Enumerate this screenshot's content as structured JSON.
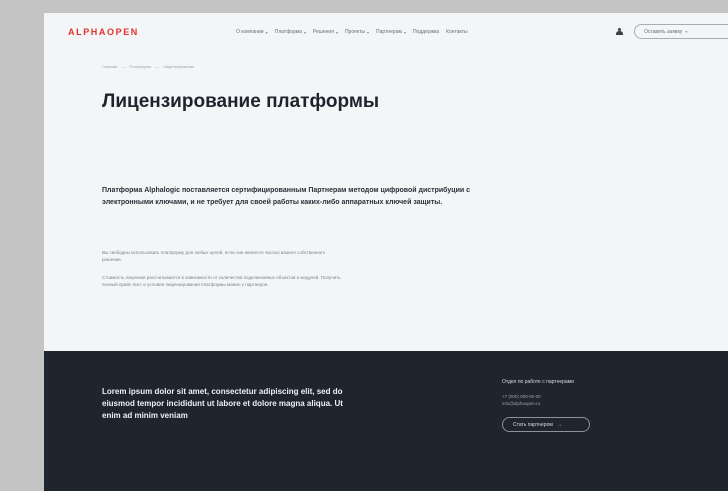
{
  "header": {
    "logo": "ALPHAOPEN",
    "nav": [
      {
        "label": "О компании",
        "has_dropdown": true
      },
      {
        "label": "Платформа",
        "has_dropdown": true
      },
      {
        "label": "Решения",
        "has_dropdown": true
      },
      {
        "label": "Проекты",
        "has_dropdown": true
      },
      {
        "label": "Партнерам",
        "has_dropdown": true
      },
      {
        "label": "Поддержка",
        "has_dropdown": false
      },
      {
        "label": "Контакты",
        "has_dropdown": false
      }
    ],
    "contact_button": "Оставить заявку"
  },
  "breadcrumb": [
    "Главная",
    "Платформа",
    "Лицензирование"
  ],
  "main": {
    "title": "Лицензирование платформы",
    "lead": "Платформа Alphalogic поставляется сертифицированным Партнерам методом цифровой дистрибуции с электронными ключами, и не требует для своей работы каких-либо аппаратных ключей защиты.",
    "small_1": "Вы свободны использовать платформу для любых целей, если она является частью вашего собственного решения.",
    "small_2": "Стоимость лицензии рассчитывается в зависимости от количества подключаемых объектов и модулей. Получить полный прайс-лист и условия лицензирования платформы можно у партнеров."
  },
  "footer": {
    "text": "Lorem ipsum dolor sit amet, consectetur adipiscing elit, sed do eiusmod tempor incididunt ut labore et dolore magna aliqua. Ut enim ad minim veniam",
    "heading": "Отдел по работе с партнерами",
    "phone": "+7 (000) 000-00-00",
    "email": "info@alphaopen.ru",
    "partner_button": "Стать партнером"
  },
  "colors": {
    "brand": "#e0332f",
    "footer_bg": "#1f252e",
    "page_bg": "#f4f5f7"
  },
  "icons": [
    "user-icon",
    "chevron-down-icon",
    "arrow-right-icon"
  ]
}
